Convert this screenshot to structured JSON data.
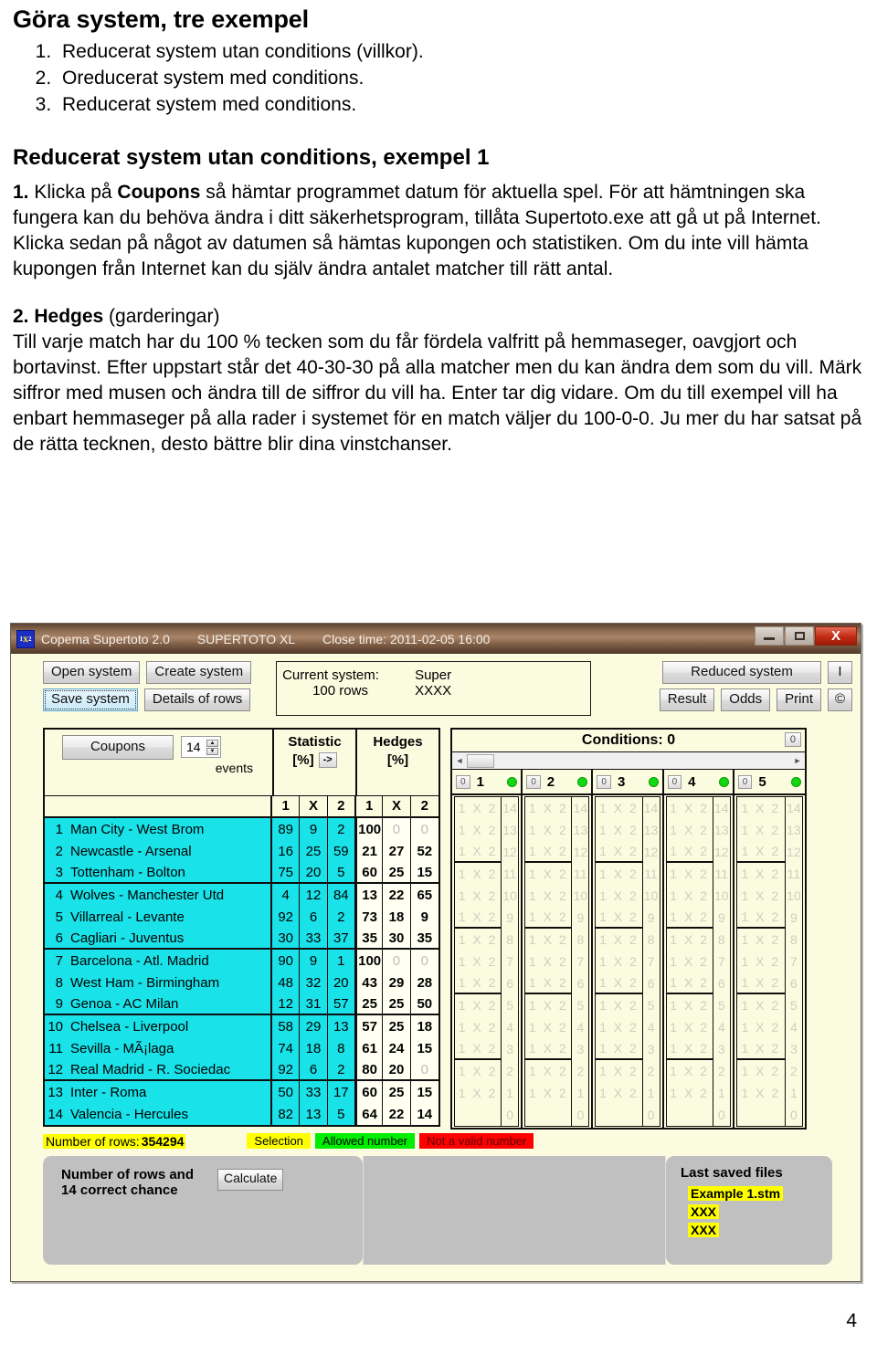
{
  "document": {
    "title": "Göra system, tre exempel",
    "intro_list": [
      "Reducerat system utan conditions (villkor).",
      "Oreducerat system med conditions.",
      "Reducerat system med conditions."
    ],
    "subtitle": "Reducerat system utan conditions, exempel 1",
    "para1_num": "1.",
    "para1_pre": " Klicka på ",
    "para1_bold": "Coupons",
    "para1_post": " så hämtar programmet datum för aktuella spel. För att hämtningen ska fungera kan du behöva ändra i ditt säkerhetsprogram, tillåta Supertoto.exe att gå ut på Internet.",
    "para2": "Klicka sedan på något av datumen så hämtas kupongen och statistiken. Om du inte vill hämta kupongen från Internet kan du själv ändra antalet matcher till rätt antal.",
    "para3_num": "2.",
    "para3_bold": " Hedges",
    "para3_post": " (garderingar)",
    "para4": "Till varje match har du 100 % tecken som du får fördela valfritt på hemmaseger, oavgjort och bortavinst. Efter uppstart står det 40-30-30 på alla matcher men du kan ändra dem som du vill. Märk siffror med musen och ändra till de siffror du vill ha. Enter tar dig vidare. Om du till exempel vill ha enbart hemmaseger på alla rader i systemet för en match väljer du 100-0-0. Ju mer du har satsat på de rätta tecknen, desto bättre blir dina vinstchanser.",
    "page_number": "4"
  },
  "app": {
    "titlebar": {
      "icon_label": "1x2",
      "app_name": "Copema Supertoto 2.0",
      "product": "SUPERTOTO XL",
      "close_time": "Close time: 2011-02-05 16:00",
      "minimize": "minimize-icon",
      "maximize": "maximize-icon",
      "close": "X"
    },
    "toolbar": {
      "open_system": "Open system",
      "create_system": "Create system",
      "save_system": "Save system",
      "details_of_rows": "Details of rows",
      "current_system_label": "Current system:",
      "current_system_value": "Super",
      "rows_label": "100 rows",
      "rows_value": "XXXX",
      "reduced_system": "Reduced system",
      "info": "I",
      "result": "Result",
      "odds": "Odds",
      "print": "Print",
      "copyright": "©"
    },
    "coupons": {
      "button": "Coupons",
      "events_count": "14",
      "events_label": "events",
      "spin_up": "▲",
      "spin_down": "▼"
    },
    "columns": {
      "statistic_title": "Statistic",
      "statistic_pct": "[%]",
      "statistic_arrow": "->",
      "hedges_title": "Hedges",
      "hedges_pct": "[%]",
      "sub_headers": [
        "1",
        "X",
        "2"
      ]
    },
    "matches": [
      {
        "no": "1",
        "name": "Man City - West Brom",
        "stat": [
          "89",
          "9",
          "2"
        ],
        "hedge": [
          "100",
          "0",
          "0"
        ],
        "grpend": false
      },
      {
        "no": "2",
        "name": "Newcastle - Arsenal",
        "stat": [
          "16",
          "25",
          "59"
        ],
        "hedge": [
          "21",
          "27",
          "52"
        ],
        "grpend": false
      },
      {
        "no": "3",
        "name": "Tottenham - Bolton",
        "stat": [
          "75",
          "20",
          "5"
        ],
        "hedge": [
          "60",
          "25",
          "15"
        ],
        "grpend": true
      },
      {
        "no": "4",
        "name": "Wolves - Manchester Utd",
        "stat": [
          "4",
          "12",
          "84"
        ],
        "hedge": [
          "13",
          "22",
          "65"
        ],
        "grpend": false
      },
      {
        "no": "5",
        "name": "Villarreal - Levante",
        "stat": [
          "92",
          "6",
          "2"
        ],
        "hedge": [
          "73",
          "18",
          "9"
        ],
        "grpend": false
      },
      {
        "no": "6",
        "name": "Cagliari - Juventus",
        "stat": [
          "30",
          "33",
          "37"
        ],
        "hedge": [
          "35",
          "30",
          "35"
        ],
        "grpend": true
      },
      {
        "no": "7",
        "name": "Barcelona - Atl. Madrid",
        "stat": [
          "90",
          "9",
          "1"
        ],
        "hedge": [
          "100",
          "0",
          "0"
        ],
        "grpend": false
      },
      {
        "no": "8",
        "name": "West Ham - Birmingham",
        "stat": [
          "48",
          "32",
          "20"
        ],
        "hedge": [
          "43",
          "29",
          "28"
        ],
        "grpend": false
      },
      {
        "no": "9",
        "name": "Genoa - AC Milan",
        "stat": [
          "12",
          "31",
          "57"
        ],
        "hedge": [
          "25",
          "25",
          "50"
        ],
        "grpend": true
      },
      {
        "no": "10",
        "name": "Chelsea - Liverpool",
        "stat": [
          "58",
          "29",
          "13"
        ],
        "hedge": [
          "57",
          "25",
          "18"
        ],
        "grpend": false
      },
      {
        "no": "11",
        "name": "Sevilla - MÃ¡laga",
        "stat": [
          "74",
          "18",
          "8"
        ],
        "hedge": [
          "61",
          "24",
          "15"
        ],
        "grpend": false
      },
      {
        "no": "12",
        "name": "Real Madrid - R. Sociedac",
        "stat": [
          "92",
          "6",
          "2"
        ],
        "hedge": [
          "80",
          "20",
          "0"
        ],
        "grpend": true
      },
      {
        "no": "13",
        "name": "Inter - Roma",
        "stat": [
          "50",
          "33",
          "17"
        ],
        "hedge": [
          "60",
          "25",
          "15"
        ],
        "grpend": false
      },
      {
        "no": "14",
        "name": "Valencia - Hercules",
        "stat": [
          "82",
          "13",
          "5"
        ],
        "hedge": [
          "64",
          "22",
          "14"
        ],
        "grpend": false
      }
    ],
    "conditions": {
      "title": "Conditions: 0",
      "count_box": "0",
      "scroll_left": "◄",
      "scroll_right": "►",
      "columns": [
        {
          "zero": "0",
          "index": "1",
          "led": "green"
        },
        {
          "zero": "0",
          "index": "2",
          "led": "green"
        },
        {
          "zero": "0",
          "index": "3",
          "led": "green"
        },
        {
          "zero": "0",
          "index": "4",
          "led": "green"
        },
        {
          "zero": "0",
          "index": "5",
          "led": "green"
        }
      ],
      "sign_text": "1 X 2",
      "row_numbers": [
        "14",
        "13",
        "12",
        "11",
        "10",
        "9",
        "8",
        "7",
        "6",
        "5",
        "4",
        "3",
        "2",
        "1",
        "0"
      ]
    },
    "status": {
      "rows_label": "Number of rows:",
      "rows_value": "354294",
      "legend": [
        {
          "text": "Selection",
          "color": "#ffff00"
        },
        {
          "text": "Allowed number",
          "color": "#00ee00"
        },
        {
          "text": "Not a valid number",
          "color": "#ff0000"
        }
      ]
    },
    "bottom": {
      "calc_title_l1": "Number of rows and",
      "calc_title_l2": "14 correct chance",
      "calculate": "Calculate",
      "last_saved_title": "Last saved files",
      "last_saved_files": [
        "Example 1.stm",
        "XXX",
        "XXX"
      ]
    }
  }
}
